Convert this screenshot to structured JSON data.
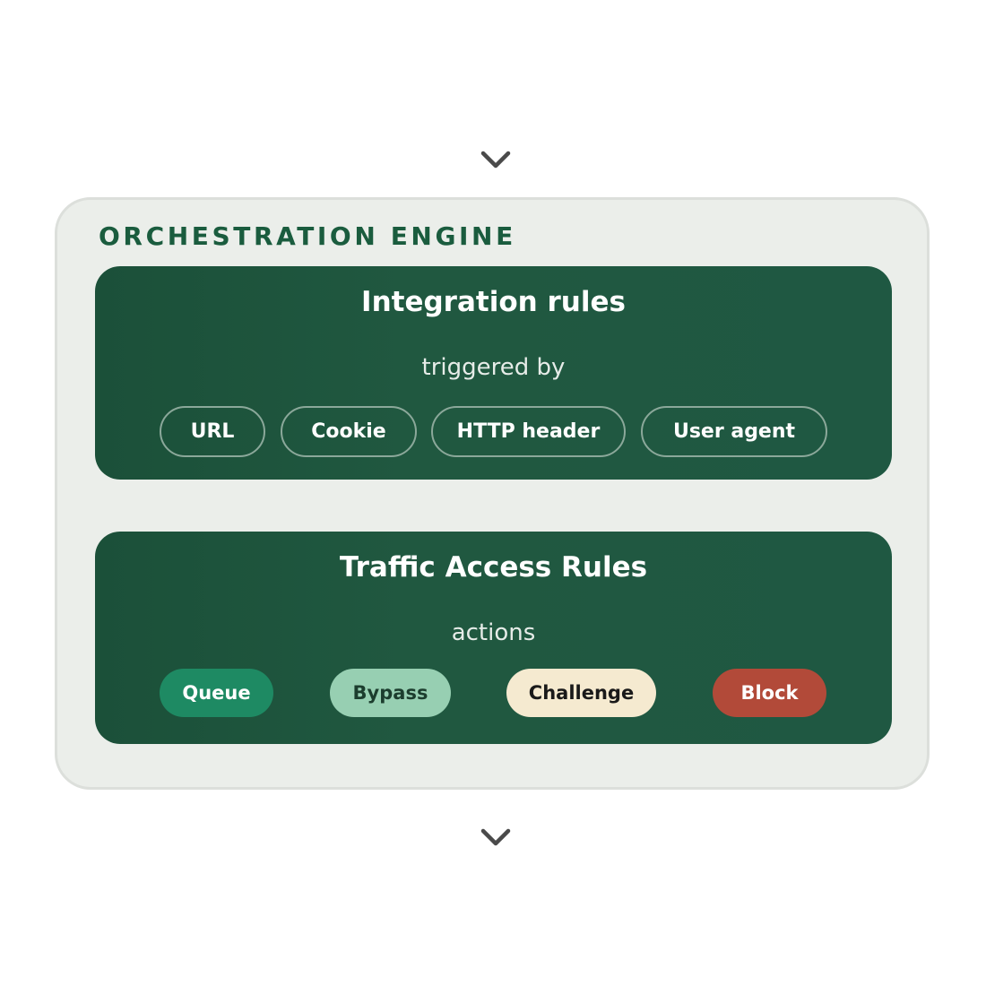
{
  "engine": {
    "title": "ORCHESTRATION ENGINE"
  },
  "integration_rules": {
    "title": "Integration rules",
    "subtitle": "triggered by",
    "triggers": [
      "URL",
      "Cookie",
      "HTTP header",
      "User agent"
    ]
  },
  "traffic_access_rules": {
    "title": "Traffic Access Rules",
    "subtitle": "actions",
    "actions": [
      {
        "label": "Queue",
        "bg": "#1e8a63",
        "color": "#ffffff"
      },
      {
        "label": "Bypass",
        "bg": "#97cfb2",
        "color": "#1c3d2e"
      },
      {
        "label": "Challenge",
        "bg": "#f5ead0",
        "color": "#1a1a1a"
      },
      {
        "label": "Block",
        "bg": "#b24a39",
        "color": "#ffffff"
      }
    ]
  },
  "colors": {
    "panel_green": "#1f5840",
    "engine_background": "#ebeeea",
    "title_green": "#1a5c3e",
    "chevron": "#4a4a4a"
  },
  "icons": {
    "top": "chevron-down-icon",
    "bottom": "chevron-down-icon"
  }
}
